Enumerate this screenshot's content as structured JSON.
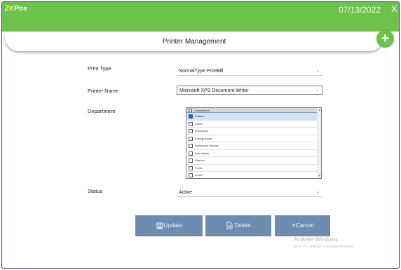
{
  "header": {
    "logo_prefix": "ZK",
    "logo_suffix": "Pos",
    "date": "07/13/2022",
    "close_glyph": "X",
    "accent_color": "#6cc24a"
  },
  "page": {
    "title": "Printer Management",
    "add_glyph": "+"
  },
  "form": {
    "print_type_label": "Print Type",
    "print_type_value": "NormalType PrintBill",
    "printer_name_label": "Printer Name",
    "printer_name_value": "Microsoft XPS Document Writer",
    "department_label": "Department",
    "status_label": "Status",
    "status_value": "Active"
  },
  "department_list": {
    "header": "Department",
    "items": [
      {
        "label": "Shakes",
        "checked": true
      },
      {
        "label": "Juices",
        "checked": false
      },
      {
        "label": "Smoothies",
        "checked": false
      },
      {
        "label": "Energy Bowls",
        "checked": false
      },
      {
        "label": "Boiled and Gelatos",
        "checked": false
      },
      {
        "label": "Keto Meals",
        "checked": false
      },
      {
        "label": "Starters",
        "checked": false
      },
      {
        "label": "Fruits",
        "checked": false
      },
      {
        "label": "Lunch",
        "checked": false
      }
    ]
  },
  "buttons": {
    "update": "Update",
    "delete": "Delete",
    "cancel": "Cancel",
    "button_color": "#6e8cb0"
  },
  "watermark": {
    "line1": "Activate Windows",
    "line2": "Go to PC settings to activate Windows."
  }
}
